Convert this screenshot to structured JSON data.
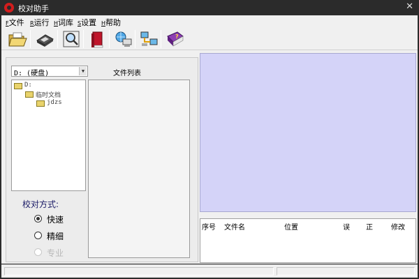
{
  "window": {
    "title": "校对助手"
  },
  "menu": [
    {
      "accel": "F",
      "label": "文件"
    },
    {
      "accel": "R",
      "label": "运行"
    },
    {
      "accel": "H",
      "label": "词库"
    },
    {
      "accel": "S",
      "label": "设置"
    },
    {
      "accel": "H",
      "label": "帮助"
    }
  ],
  "toolbar": {
    "buttons": [
      "open-folder-icon",
      "save-disk-icon",
      "search-magnifier-icon",
      "book-icon",
      "network-globe-icon",
      "computers-network-icon",
      "help-book-icon"
    ]
  },
  "left_panel": {
    "drive_select": {
      "value": "D: (硬盘)"
    },
    "file_list_label": "文件列表",
    "tree": [
      {
        "label": "D:"
      },
      {
        "label": "临时文档"
      },
      {
        "label": "jdzs"
      }
    ],
    "mode_title": "校对方式:",
    "modes": [
      {
        "label": "快速",
        "checked": true,
        "disabled": false
      },
      {
        "label": "精细",
        "checked": false,
        "disabled": false
      },
      {
        "label": "专业",
        "checked": false,
        "disabled": true
      }
    ]
  },
  "results_table": {
    "columns": [
      "序号",
      "文件名",
      "位置",
      "误",
      "正",
      "修改"
    ]
  },
  "colors": {
    "preview_bg": "#d4d3f8",
    "titlebar_bg": "#2b2b2b",
    "app_icon": "#d21d1d"
  }
}
